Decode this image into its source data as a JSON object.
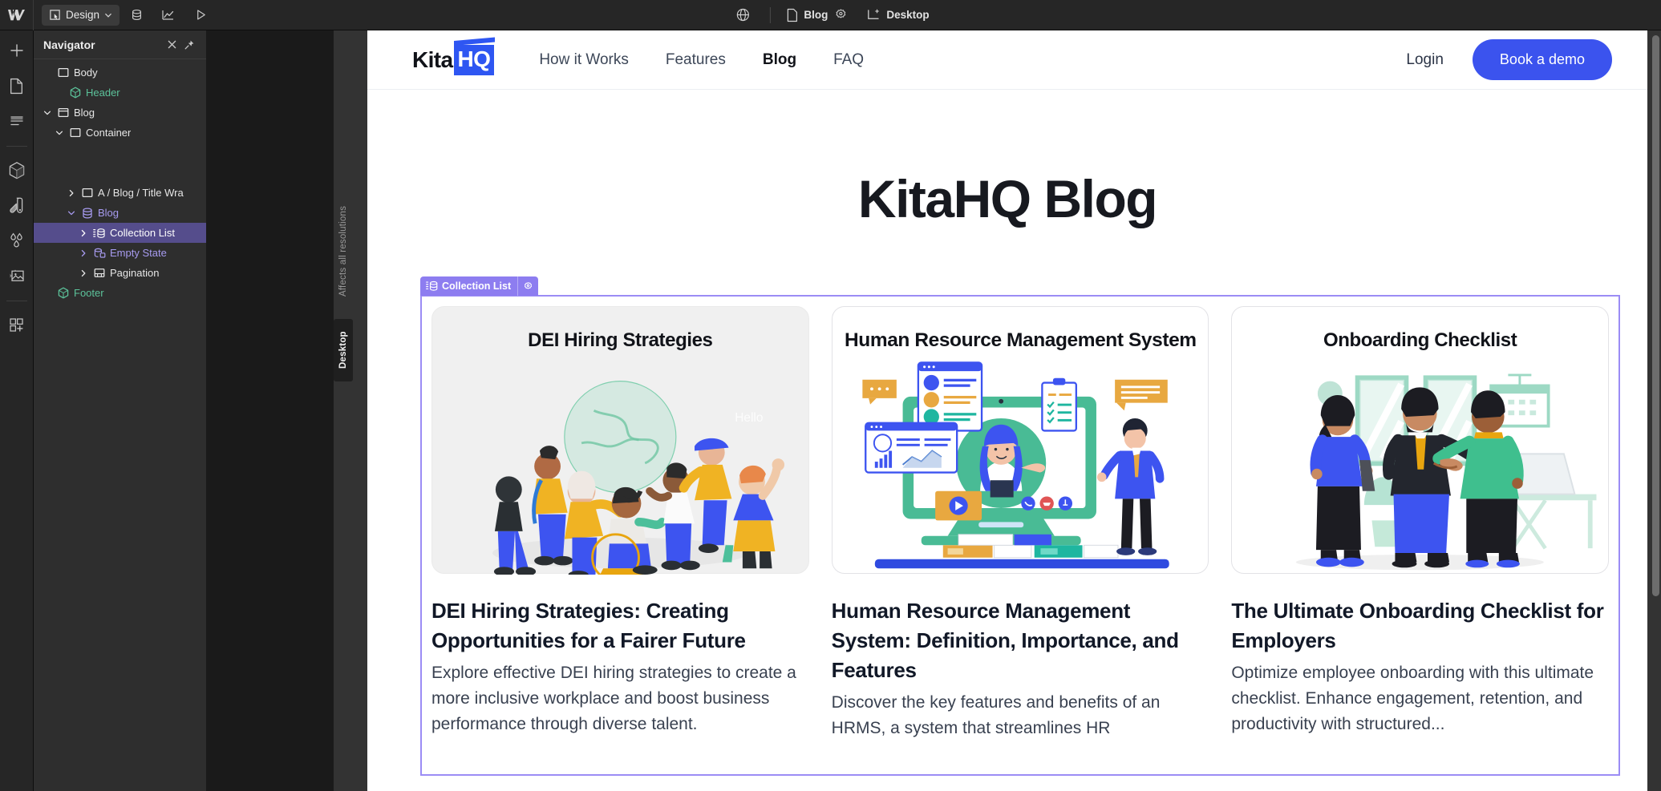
{
  "app": {
    "name": "Webflow Designer",
    "topbar": {
      "logo_icon": "webflow-logo-icon",
      "mode_label": "Design",
      "mode_caret_icon": "chevron-down-icon",
      "cms_icon": "database-icon",
      "analyze_icon": "line-chart-icon",
      "preview_icon": "play-icon",
      "globe_icon": "globe-icon",
      "page_icon": "page-icon",
      "page_label": "Blog",
      "page_settings_icon": "gear-icon",
      "breakpoint_icon": "desktop-breakpoint-icon",
      "breakpoint_label": "Desktop"
    },
    "rail": [
      {
        "name": "add-elements",
        "icon": "plus-icon"
      },
      {
        "name": "pages",
        "icon": "page-icon"
      },
      {
        "name": "navigator",
        "icon": "layers-icon"
      },
      {
        "name": "components",
        "icon": "cube-icon"
      },
      {
        "name": "style-selector",
        "icon": "paint-swatch-icon"
      },
      {
        "name": "variables",
        "icon": "droplets-icon"
      },
      {
        "name": "assets",
        "icon": "image-icon"
      },
      {
        "name": "apps",
        "icon": "grid-plus-icon"
      }
    ],
    "navigator": {
      "title": "Navigator",
      "close_icon": "close-icon",
      "pin_icon": "pin-icon",
      "tree": [
        {
          "label": "Body",
          "icon": "body-icon",
          "indent": 0,
          "caret": "none",
          "color": "white",
          "selected": false
        },
        {
          "label": "Header",
          "icon": "component-icon",
          "indent": 1,
          "caret": "none",
          "color": "green",
          "selected": false
        },
        {
          "label": "Blog",
          "icon": "section-icon",
          "indent": 0,
          "caret": "down",
          "color": "white",
          "selected": false
        },
        {
          "label": "Container",
          "icon": "container-icon",
          "indent": 1,
          "caret": "down",
          "color": "white",
          "selected": false
        },
        {
          "label": "",
          "icon": "none",
          "indent": 2,
          "caret": "none",
          "color": "white",
          "selected": false
        },
        {
          "label": "",
          "icon": "none",
          "indent": 2,
          "caret": "none",
          "color": "white",
          "selected": false
        },
        {
          "label": "A / Blog / Title Wra",
          "icon": "div-icon",
          "indent": 2,
          "caret": "right",
          "color": "white",
          "selected": false
        },
        {
          "label": "Blog",
          "icon": "collection-icon",
          "indent": 2,
          "caret": "down",
          "color": "purple",
          "selected": false
        },
        {
          "label": "Collection List",
          "icon": "collection-list-icon",
          "indent": 3,
          "caret": "right",
          "color": "sel",
          "selected": true
        },
        {
          "label": "Empty State",
          "icon": "empty-state-icon",
          "indent": 3,
          "caret": "right",
          "color": "purple",
          "selected": false
        },
        {
          "label": "Pagination",
          "icon": "pagination-icon",
          "indent": 3,
          "caret": "right",
          "color": "white",
          "selected": false
        },
        {
          "label": "Footer",
          "icon": "component-icon",
          "indent": 0,
          "caret": "none",
          "color": "green",
          "selected": false
        }
      ]
    },
    "canvas_edge_labels": {
      "all_resolutions": "Affects all resolutions",
      "breakpoint": "Desktop"
    },
    "selection_badge": {
      "icon": "collection-list-icon",
      "label": "Collection List",
      "settings_icon": "gear-icon"
    },
    "colors": {
      "brand_blue": "#3b53ee",
      "selection_purple": "#8d7df0",
      "nav_selected": "#554d8c",
      "component_green": "#5cc29a",
      "cms_purple": "#a79bf0"
    }
  },
  "site": {
    "logo": {
      "part1": "Kita",
      "part2": "HQ"
    },
    "nav": [
      {
        "label": "How it Works",
        "active": false
      },
      {
        "label": "Features",
        "active": false
      },
      {
        "label": "Blog",
        "active": true
      },
      {
        "label": "FAQ",
        "active": false
      }
    ],
    "login_label": "Login",
    "demo_label": "Book a demo",
    "page_title": "KitaHQ Blog",
    "posts": [
      {
        "thumb_title": "DEI Hiring Strategies",
        "thumb_style": "gray",
        "art": "diverse-team-globe-illustration",
        "title": "DEI Hiring Strategies: Creating Opportunities for a Fairer Future",
        "desc": "Explore effective DEI hiring strategies to create a more inclusive workplace and boost business performance through diverse talent."
      },
      {
        "thumb_title": "Human Resource Management System",
        "thumb_style": "white",
        "art": "hrms-computer-illustration",
        "title": "Human Resource Management System: Definition, Importance, and Features",
        "desc": "Discover the key features and benefits of an HRMS, a system that streamlines HR"
      },
      {
        "thumb_title": "Onboarding Checklist",
        "thumb_style": "white",
        "art": "onboarding-handshake-illustration",
        "title": "The Ultimate Onboarding Checklist for Employers",
        "desc": "Optimize employee onboarding with this ultimate checklist. Enhance engagement, retention, and productivity with structured..."
      }
    ]
  }
}
